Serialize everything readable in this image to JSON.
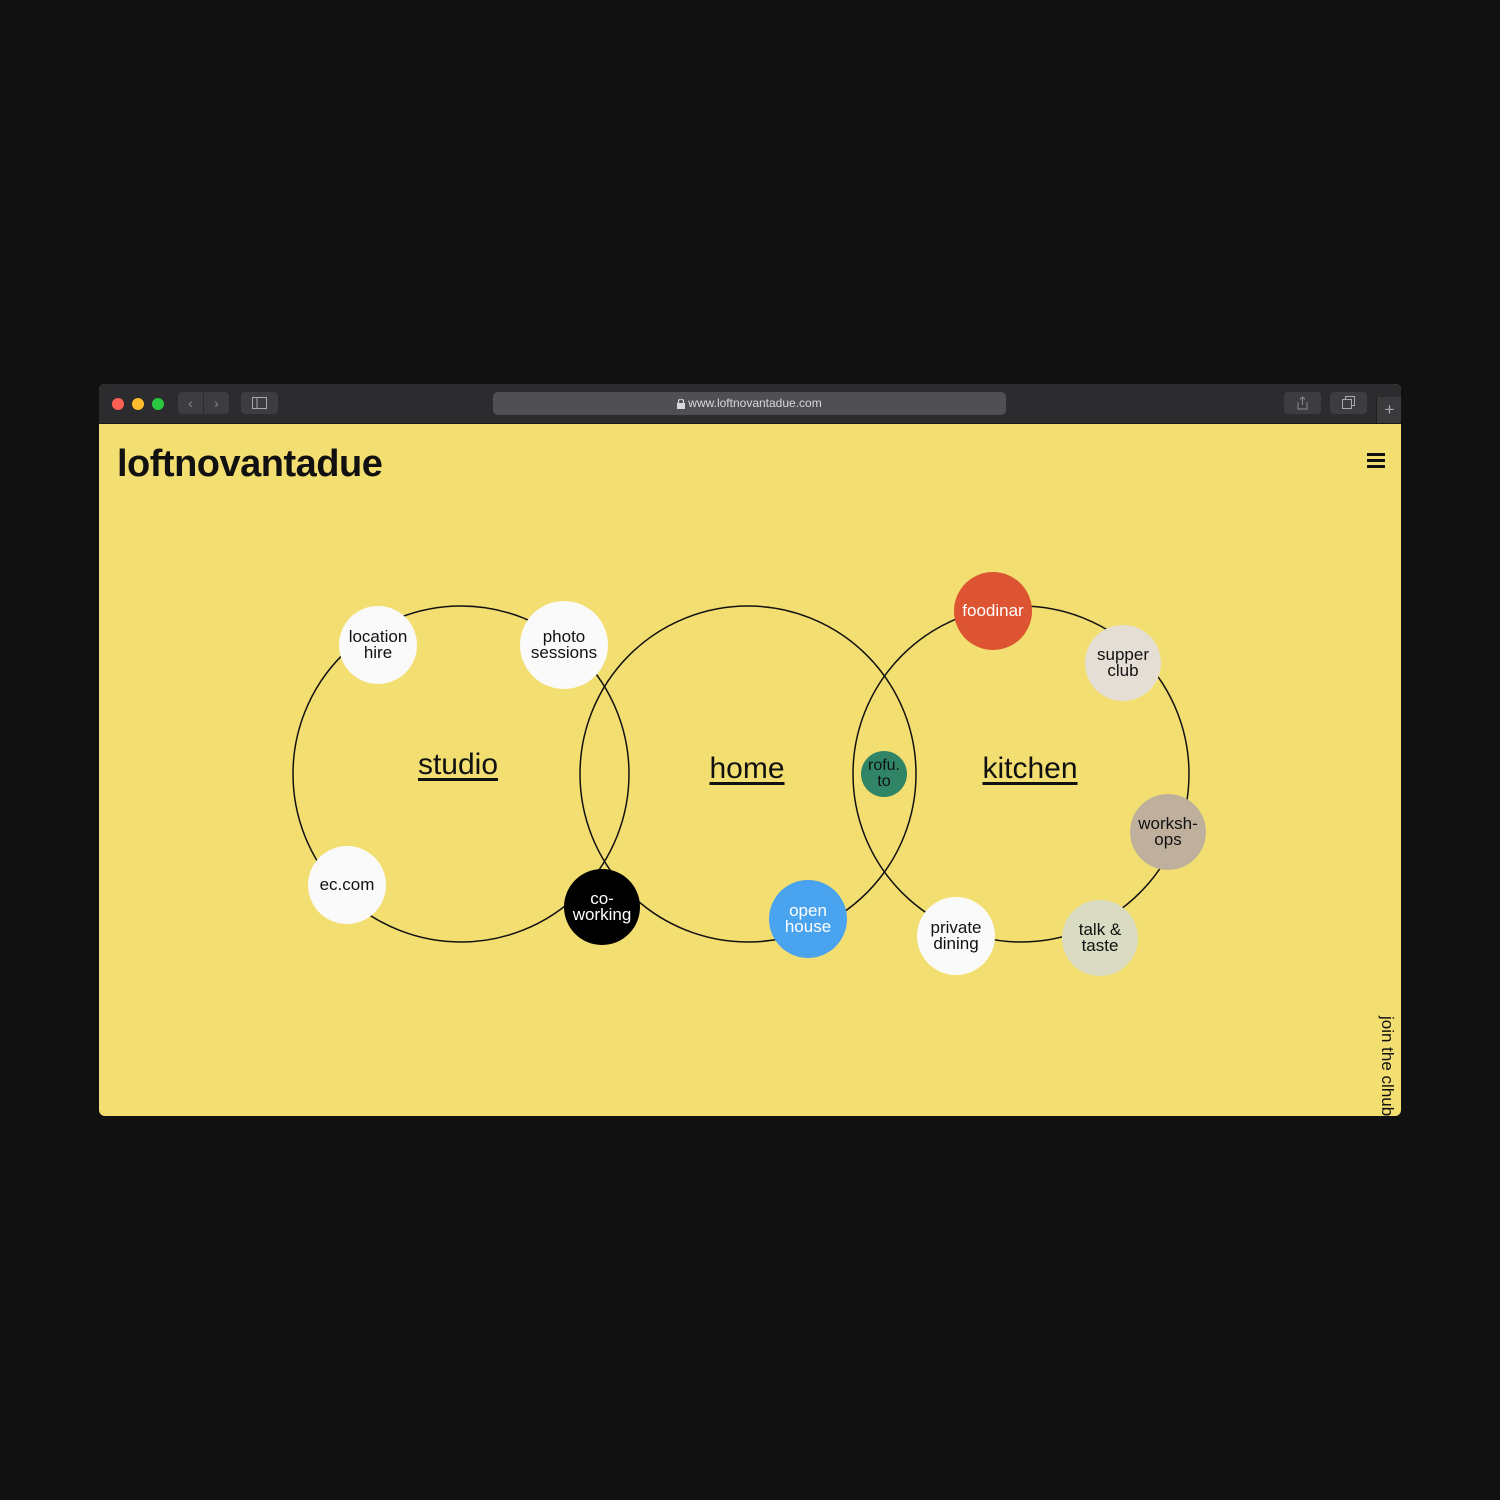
{
  "browser": {
    "url": "www.loftnovantadue.com"
  },
  "site": {
    "logo": "loftnovantadue",
    "join_label": "join the clhub"
  },
  "sections": [
    {
      "id": "studio",
      "label": "studio"
    },
    {
      "id": "home",
      "label": "home"
    },
    {
      "id": "kitchen",
      "label": "kitchen"
    }
  ],
  "bubbles": [
    {
      "id": "location-hire",
      "label": "location\nhire",
      "bg": "#fafafa",
      "color": "#111111"
    },
    {
      "id": "photo-sessions",
      "label": "photo\nsessions",
      "bg": "#fafafa",
      "color": "#111111"
    },
    {
      "id": "ec-com",
      "label": "ec.com",
      "bg": "#fafafa",
      "color": "#111111"
    },
    {
      "id": "co-working",
      "label": "co-\nworking",
      "bg": "#000000",
      "color": "#ffffff"
    },
    {
      "id": "open-house",
      "label": "open\nhouse",
      "bg": "#4aa3ef",
      "color": "#ffffff"
    },
    {
      "id": "rofu-to",
      "label": "rofu.\nto",
      "bg": "#2f8565",
      "color": "#111111"
    },
    {
      "id": "foodinar",
      "label": "foodinar",
      "bg": "#dc5431",
      "color": "#ffffff"
    },
    {
      "id": "supper-club",
      "label": "supper\nclub",
      "bg": "#e5ded5",
      "color": "#111111"
    },
    {
      "id": "workshops",
      "label": "worksh-\nops",
      "bg": "#bfb09e",
      "color": "#111111"
    },
    {
      "id": "talk-taste",
      "label": "talk &\ntaste",
      "bg": "#d9dbc2",
      "color": "#111111"
    },
    {
      "id": "private-dining",
      "label": "private\ndining",
      "bg": "#fafafa",
      "color": "#111111"
    }
  ],
  "colors": {
    "page_bg": "#f3de71",
    "outer_bg": "#111111"
  }
}
